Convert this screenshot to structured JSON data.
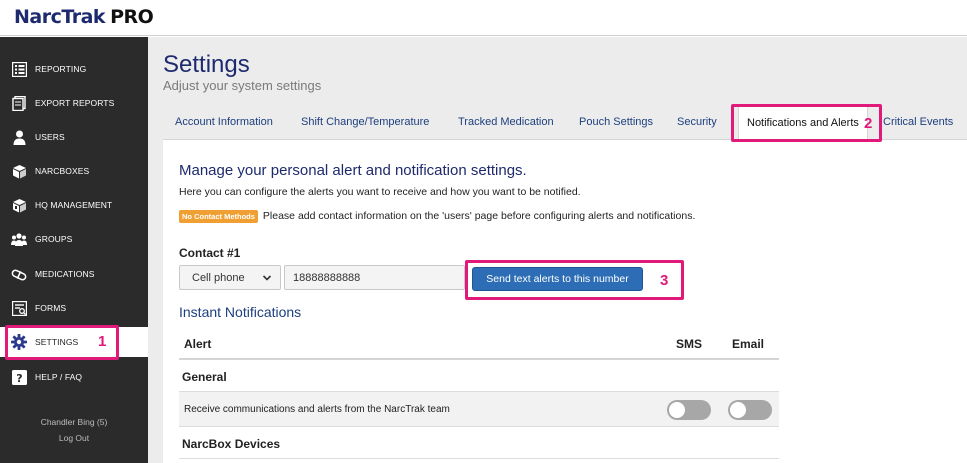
{
  "app": {
    "brand": "NarcTrak",
    "edition": "PRO"
  },
  "sidebar": {
    "items": [
      {
        "label": "REPORTING",
        "icon": "report-icon"
      },
      {
        "label": "EXPORT REPORTS",
        "icon": "export-icon"
      },
      {
        "label": "USERS",
        "icon": "user-icon"
      },
      {
        "label": "NARCBOXES",
        "icon": "box-icon"
      },
      {
        "label": "HQ MANAGEMENT",
        "icon": "hq-icon"
      },
      {
        "label": "GROUPS",
        "icon": "group-icon"
      },
      {
        "label": "MEDICATIONS",
        "icon": "pill-icon"
      },
      {
        "label": "FORMS",
        "icon": "form-icon"
      },
      {
        "label": "SETTINGS",
        "icon": "gear-icon",
        "active": true
      },
      {
        "label": "HELP / FAQ",
        "icon": "help-icon"
      }
    ],
    "user_name": "Chandler Bing (5)",
    "logout_label": "Log Out"
  },
  "page": {
    "title": "Settings",
    "subtitle": "Adjust your system settings"
  },
  "tabs": [
    {
      "label": "Account Information"
    },
    {
      "label": "Shift Change/Temperature"
    },
    {
      "label": "Tracked Medication"
    },
    {
      "label": "Pouch Settings"
    },
    {
      "label": "Security"
    },
    {
      "label": "Notifications and Alerts",
      "active": true
    },
    {
      "label": "Critical Events"
    }
  ],
  "panel": {
    "heading": "Manage your personal alert and notification settings.",
    "description": "Here you can configure the alerts you want to receive and how you want to be notified.",
    "warning_badge": "No Contact Methods",
    "warning_text": "Please add contact information on the 'users' page before configuring alerts and notifications.",
    "contact_label": "Contact #1",
    "contact_type": "Cell phone",
    "contact_value": "18888888888",
    "send_button": "Send text alerts to this number",
    "instant_heading": "Instant Notifications",
    "table": {
      "col_alert": "Alert",
      "col_sms": "SMS",
      "col_email": "Email",
      "groups": [
        {
          "name": "General",
          "rows": [
            {
              "text": "Receive communications and alerts from the NarcTrak team",
              "sms": false,
              "email": false
            }
          ]
        },
        {
          "name": "NarcBox Devices",
          "rows": []
        }
      ]
    }
  },
  "annotations": [
    "1",
    "2",
    "3"
  ],
  "colors": {
    "sidebar_bg": "#2b2b2b",
    "brand_navy": "#1d2a6e",
    "primary_button": "#2d6db5",
    "warning": "#f0a032",
    "annotation": "#e0197a",
    "toggle_off": "#a7a7a7"
  }
}
